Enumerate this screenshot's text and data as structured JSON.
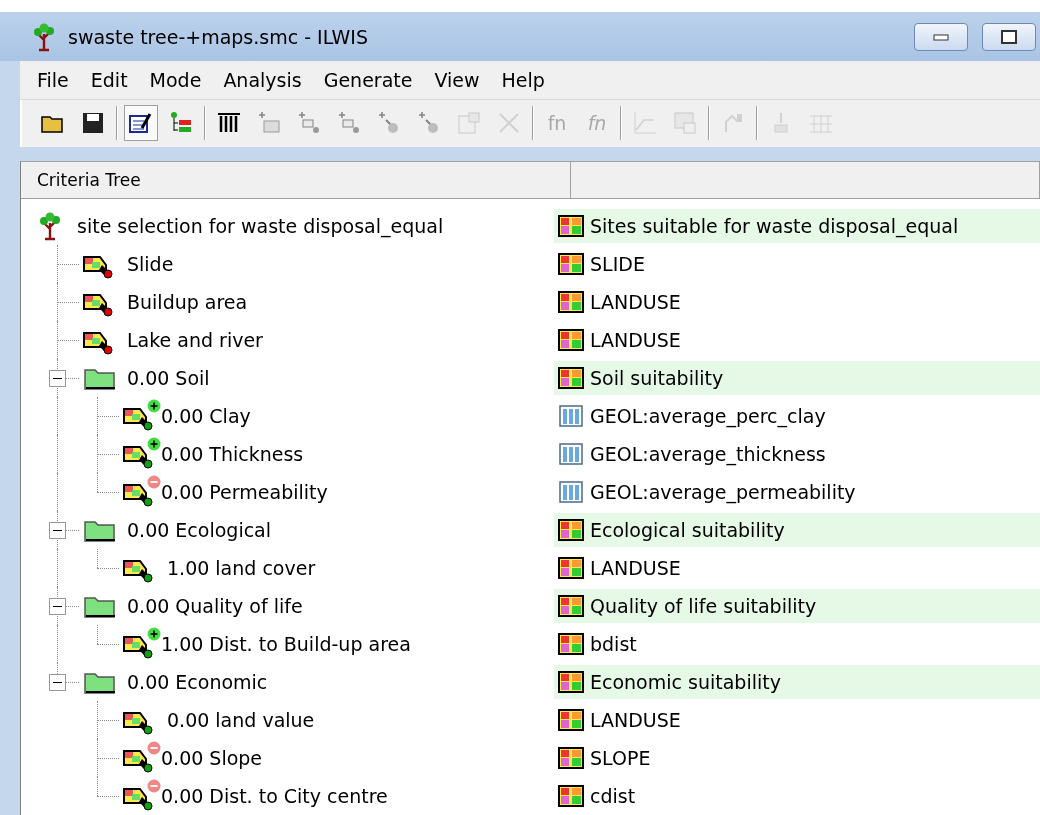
{
  "window": {
    "title": "swaste tree-+maps.smc - ILWIS"
  },
  "menu": [
    "File",
    "Edit",
    "Mode",
    "Analysis",
    "Generate",
    "View",
    "Help"
  ],
  "toolbar": [
    {
      "kind": "open",
      "disabled": false,
      "pressed": false
    },
    {
      "kind": "save",
      "disabled": false,
      "pressed": false
    },
    {
      "kind": "separator"
    },
    {
      "kind": "edit",
      "disabled": false,
      "pressed": true
    },
    {
      "kind": "tree",
      "disabled": false,
      "pressed": false
    },
    {
      "kind": "separator"
    },
    {
      "kind": "table",
      "disabled": false,
      "pressed": false
    },
    {
      "kind": "add-group",
      "disabled": true,
      "pressed": false
    },
    {
      "kind": "add-map",
      "disabled": true,
      "pressed": false
    },
    {
      "kind": "add-map",
      "disabled": true,
      "pressed": false
    },
    {
      "kind": "add-point",
      "disabled": true,
      "pressed": false
    },
    {
      "kind": "add-point",
      "disabled": true,
      "pressed": false
    },
    {
      "kind": "properties",
      "disabled": true,
      "pressed": false
    },
    {
      "kind": "delete",
      "disabled": true,
      "pressed": false
    },
    {
      "kind": "separator"
    },
    {
      "kind": "text",
      "label": "fn",
      "disabled": true,
      "pressed": false
    },
    {
      "kind": "text",
      "label": "fn",
      "disabled": true,
      "pressed": false
    },
    {
      "kind": "separator"
    },
    {
      "kind": "graph",
      "disabled": true,
      "pressed": false
    },
    {
      "kind": "window",
      "disabled": true,
      "pressed": false
    },
    {
      "kind": "separator"
    },
    {
      "kind": "fork",
      "disabled": true,
      "pressed": false
    },
    {
      "kind": "separator"
    },
    {
      "kind": "down",
      "disabled": true,
      "pressed": false
    },
    {
      "kind": "rows",
      "disabled": true,
      "pressed": false
    }
  ],
  "columns": [
    "Criteria Tree"
  ],
  "tree": {
    "kind": "goal",
    "label": "site selection for waste disposal_equal",
    "map": {
      "kind": "raster",
      "name": "Sites suitable for waste disposal_equal"
    },
    "children": [
      {
        "kind": "constraint",
        "label": "Slide",
        "map": {
          "kind": "raster",
          "name": "SLIDE"
        }
      },
      {
        "kind": "constraint",
        "label": "Buildup area",
        "map": {
          "kind": "raster",
          "name": "LANDUSE"
        }
      },
      {
        "kind": "constraint",
        "label": "Lake and river",
        "map": {
          "kind": "raster",
          "name": "LANDUSE"
        }
      },
      {
        "kind": "group",
        "label": "0.00 Soil",
        "expanded": true,
        "map": {
          "kind": "raster",
          "name": "Soil suitability"
        },
        "children": [
          {
            "kind": "factor",
            "positive": true,
            "label": "0.00 Clay",
            "map": {
              "kind": "table",
              "name": "GEOL:average_perc_clay"
            }
          },
          {
            "kind": "factor",
            "positive": true,
            "label": "0.00 Thickness",
            "map": {
              "kind": "table",
              "name": "GEOL:average_thickness"
            }
          },
          {
            "kind": "factor",
            "positive": false,
            "label": "0.00 Permeability",
            "map": {
              "kind": "table",
              "name": "GEOL:average_permeability"
            }
          }
        ]
      },
      {
        "kind": "group",
        "label": "0.00 Ecological",
        "expanded": true,
        "map": {
          "kind": "raster",
          "name": "Ecological suitability"
        },
        "children": [
          {
            "kind": "factor",
            "label": "1.00 land cover",
            "map": {
              "kind": "raster",
              "name": "LANDUSE"
            }
          }
        ]
      },
      {
        "kind": "group",
        "label": "0.00 Quality of life",
        "expanded": true,
        "map": {
          "kind": "raster",
          "name": "Quality of life suitability"
        },
        "children": [
          {
            "kind": "factor",
            "positive": true,
            "label": "1.00 Dist. to Build-up area",
            "map": {
              "kind": "raster",
              "name": "bdist"
            }
          }
        ]
      },
      {
        "kind": "group",
        "label": "0.00 Economic",
        "expanded": true,
        "map": {
          "kind": "raster",
          "name": "Economic suitability"
        },
        "children": [
          {
            "kind": "factor",
            "label": "0.00 land value",
            "map": {
              "kind": "raster",
              "name": "LANDUSE"
            }
          },
          {
            "kind": "factor",
            "positive": false,
            "label": "0.00 Slope",
            "map": {
              "kind": "raster",
              "name": "SLOPE"
            }
          },
          {
            "kind": "factor",
            "positive": false,
            "label": "0.00 Dist. to City centre",
            "map": {
              "kind": "raster",
              "name": "cdist"
            }
          }
        ]
      }
    ]
  }
}
